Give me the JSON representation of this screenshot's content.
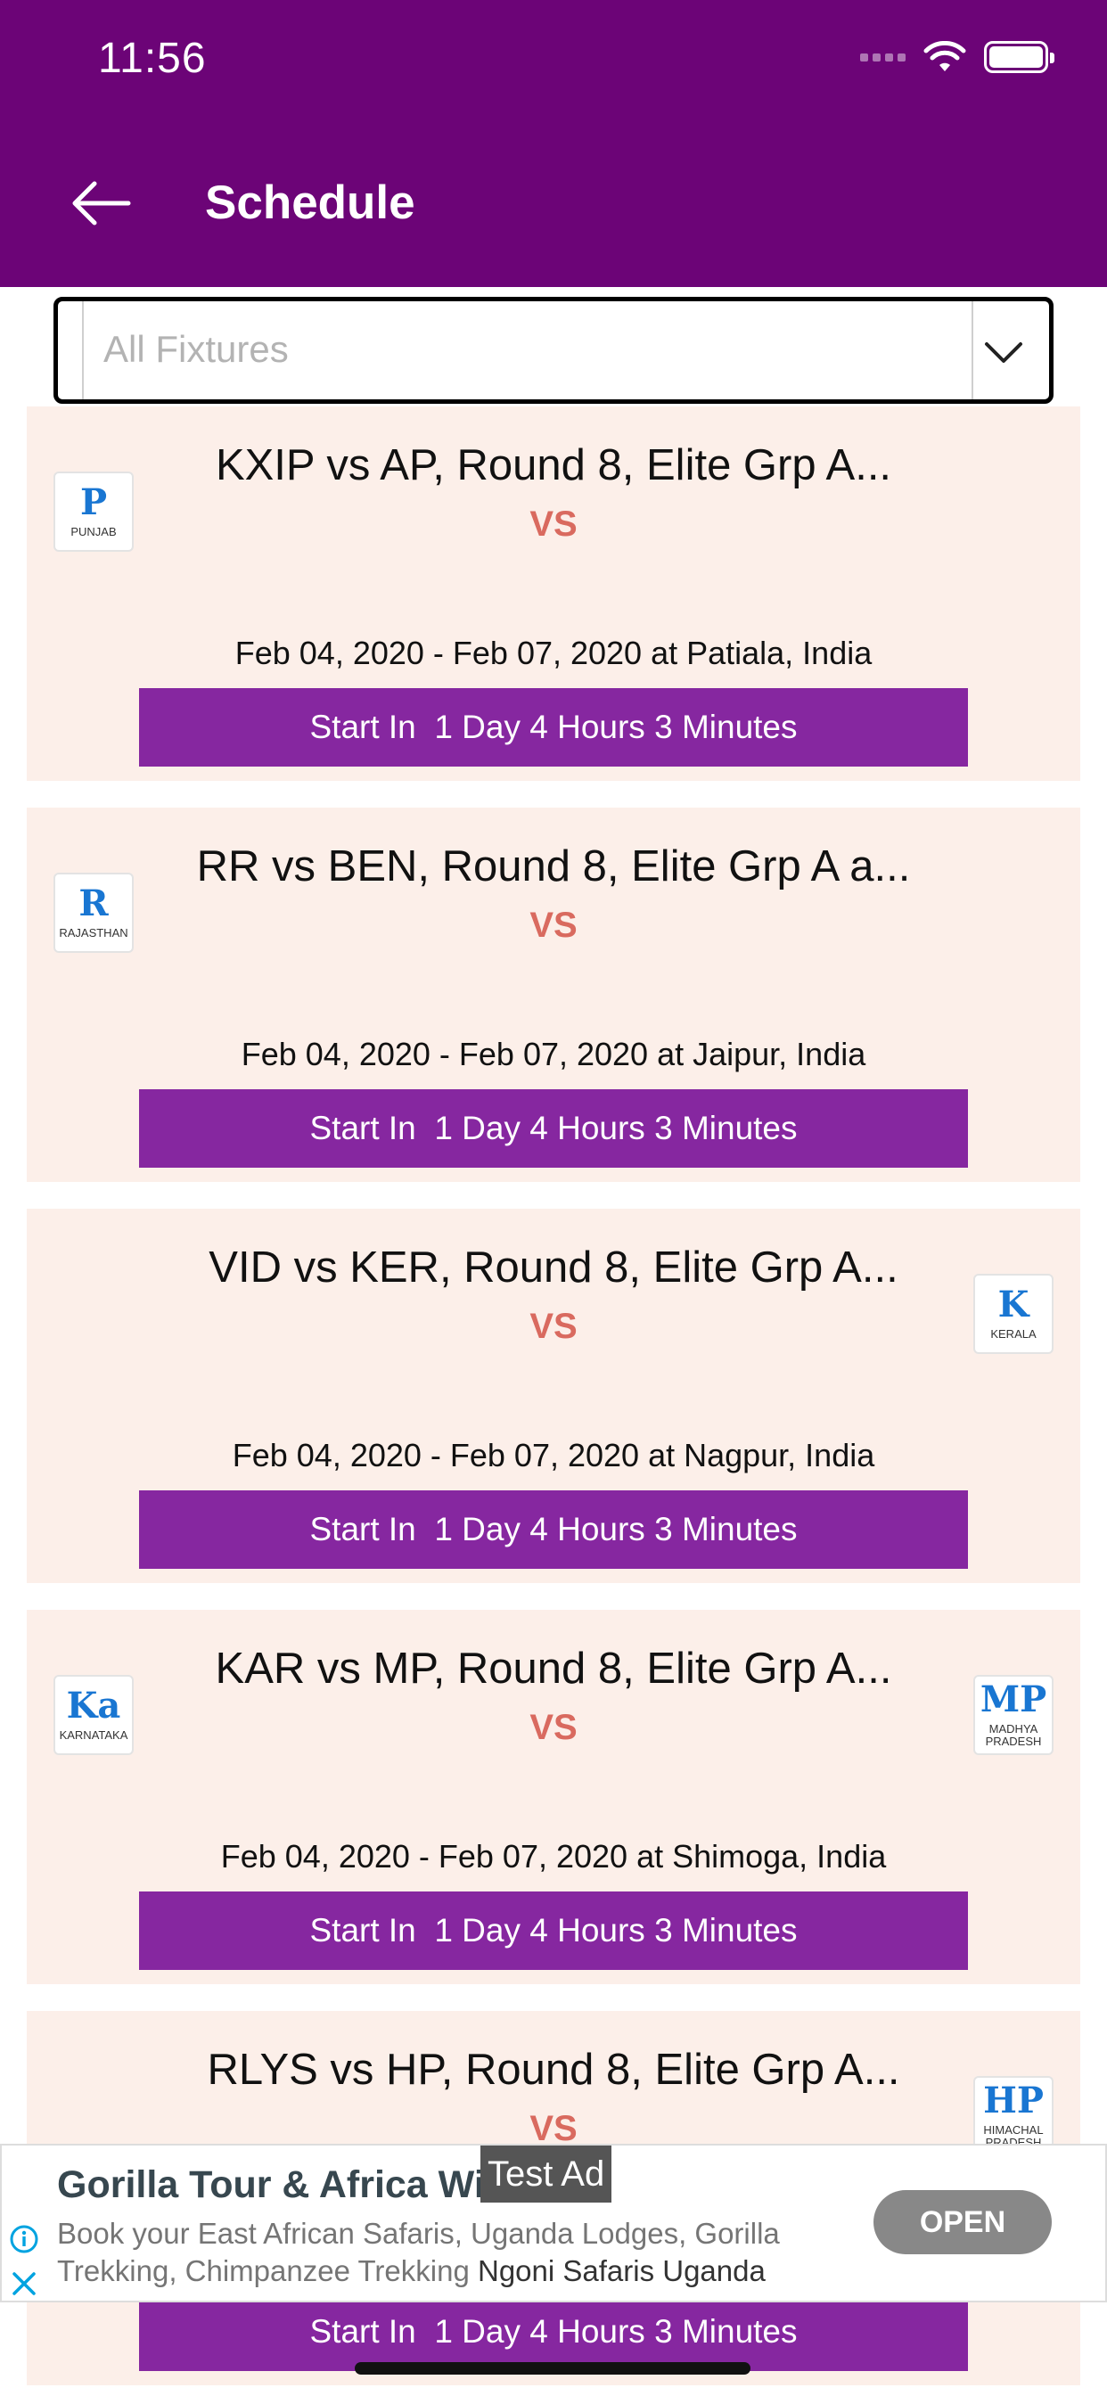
{
  "status_bar": {
    "time": "11:56"
  },
  "header": {
    "title": "Schedule"
  },
  "filter": {
    "placeholder": "All Fixtures"
  },
  "fixtures": [
    {
      "title": "KXIP vs AP, Round 8, Elite Grp A...",
      "vs": "VS",
      "dates": "Feb 04, 2020 - Feb 07, 2020 at Patiala, India",
      "start": "Start In  1 Day 4 Hours 3 Minutes",
      "left_logo": {
        "abbr": "P",
        "name": "PUNJAB"
      },
      "right_logo": null
    },
    {
      "title": "RR vs BEN, Round 8, Elite Grp A a...",
      "vs": "VS",
      "dates": "Feb 04, 2020 - Feb 07, 2020 at Jaipur, India",
      "start": "Start In  1 Day 4 Hours 3 Minutes",
      "left_logo": {
        "abbr": "R",
        "name": "RAJASTHAN"
      },
      "right_logo": null
    },
    {
      "title": "VID vs KER, Round 8, Elite Grp A...",
      "vs": "VS",
      "dates": "Feb 04, 2020 - Feb 07, 2020 at Nagpur, India",
      "start": "Start In  1 Day 4 Hours 3 Minutes",
      "left_logo": null,
      "right_logo": {
        "abbr": "K",
        "name": "KERALA"
      }
    },
    {
      "title": "KAR vs MP, Round 8, Elite Grp A...",
      "vs": "VS",
      "dates": "Feb 04, 2020 - Feb 07, 2020 at Shimoga, India",
      "start": "Start In  1 Day 4 Hours 3 Minutes",
      "left_logo": {
        "abbr": "Ka",
        "name": "KARNATAKA"
      },
      "right_logo": {
        "abbr": "MP",
        "name": "MADHYA PRADESH"
      }
    },
    {
      "title": "RLYS vs HP, Round 8, Elite Grp A...",
      "vs": "VS",
      "dates": "",
      "start": "Start In  1 Day 4 Hours 3 Minutes",
      "left_logo": null,
      "right_logo": {
        "abbr": "HP",
        "name": "HIMACHAL PRADESH"
      }
    }
  ],
  "ad": {
    "title": "Gorilla Tour & Africa Wil",
    "tag": "Test Ad",
    "description": "Book your East African Safaris, Uganda Lodges, Gorilla Trekking, Chimpanzee Trekking",
    "advertiser": "Ngoni Safaris Uganda",
    "cta": "OPEN"
  }
}
